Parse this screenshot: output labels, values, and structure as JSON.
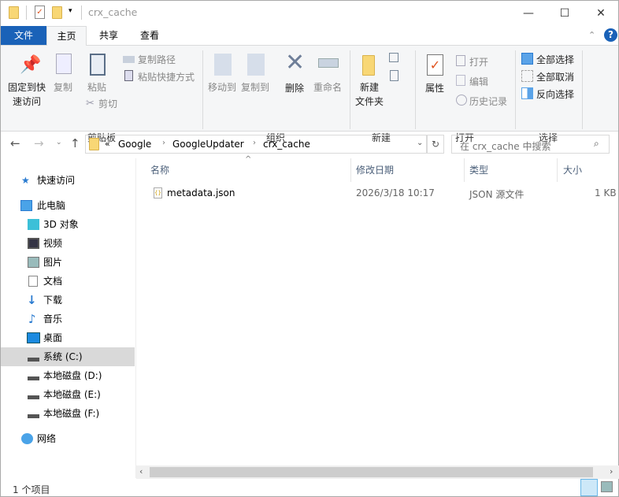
{
  "window": {
    "title": "crx_cache",
    "minimize": "—",
    "maximize": "☐",
    "close": "✕"
  },
  "tabs": [
    {
      "label": "文件"
    },
    {
      "label": "主页"
    },
    {
      "label": "共享"
    },
    {
      "label": "查看"
    }
  ],
  "ribbon": {
    "clipboard": {
      "pin": "固定到快",
      "pin2": "速访问",
      "copy": "复制",
      "paste": "粘贴",
      "copy_path": "复制路径",
      "paste_shortcut": "粘贴快捷方式",
      "cut": "剪切",
      "group": "剪贴板"
    },
    "organize": {
      "move_to": "移动到",
      "copy_to": "复制到",
      "delete": "删除",
      "rename": "重命名",
      "group": "组织"
    },
    "new": {
      "new_folder": "新建",
      "new_folder2": "文件夹",
      "group": "新建"
    },
    "open": {
      "properties": "属性",
      "open": "打开",
      "edit": "编辑",
      "history": "历史记录",
      "group": "打开"
    },
    "select": {
      "select_all": "全部选择",
      "select_none": "全部取消",
      "invert": "反向选择",
      "group": "选择"
    }
  },
  "address": {
    "overflow": "«",
    "crumbs": [
      "Google",
      "GoogleUpdater",
      "crx_cache"
    ],
    "search_placeholder": "在 crx_cache 中搜索"
  },
  "sidebar": {
    "quick_access": "快速访问",
    "this_pc": "此电脑",
    "items": [
      "3D 对象",
      "视频",
      "图片",
      "文档",
      "下载",
      "音乐",
      "桌面",
      "系统 (C:)",
      "本地磁盘 (D:)",
      "本地磁盘 (E:)",
      "本地磁盘 (F:)"
    ],
    "network": "网络",
    "selected": "系统 (C:)"
  },
  "columns": {
    "name": "名称",
    "modified": "修改日期",
    "type": "类型",
    "size": "大小"
  },
  "files": [
    {
      "name": "metadata.json",
      "modified": "2026/3/18 10:17",
      "type": "JSON 源文件",
      "size": "1 KB"
    }
  ],
  "status": {
    "count": "1 个项目"
  },
  "colors": {
    "accent": "#1a62b8",
    "selected": "#d9d9d9"
  }
}
